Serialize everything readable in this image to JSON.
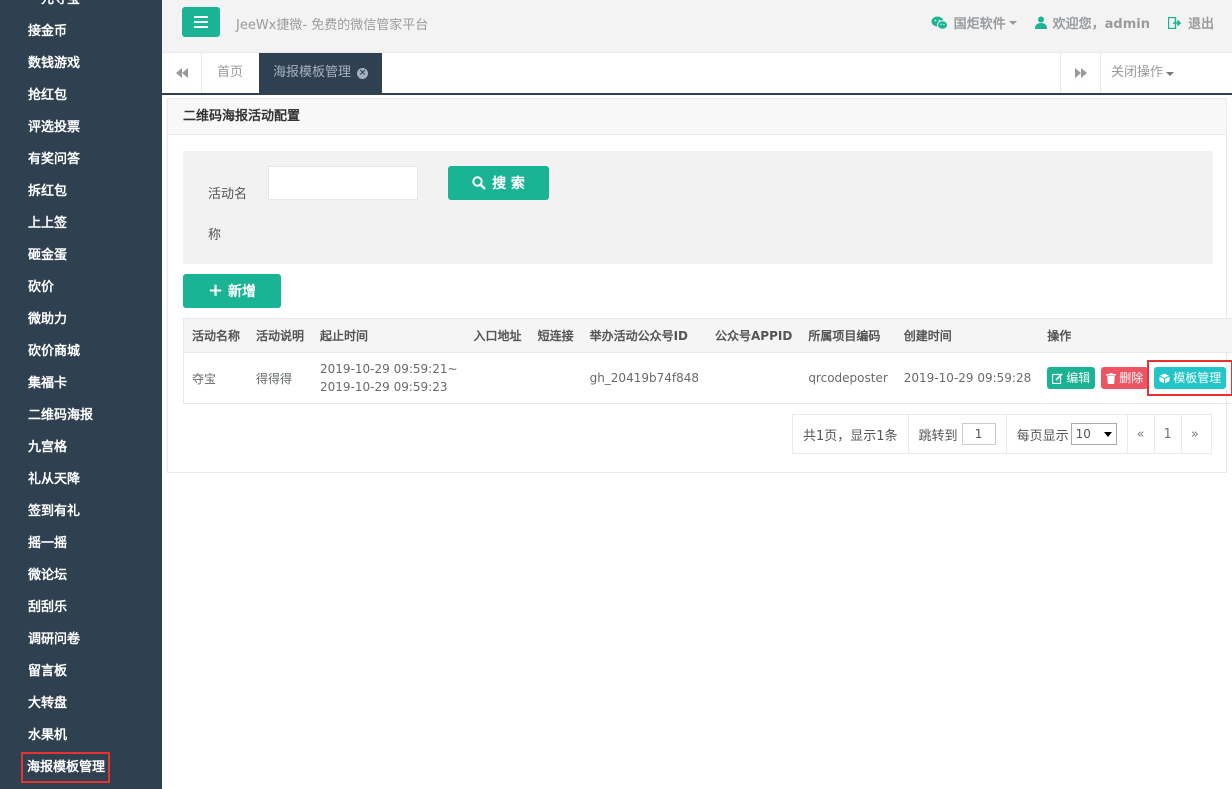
{
  "sidebar": {
    "items": [
      {
        "label": "一元夺宝"
      },
      {
        "label": "接金币"
      },
      {
        "label": "数钱游戏"
      },
      {
        "label": "抢红包"
      },
      {
        "label": "评选投票"
      },
      {
        "label": "有奖问答"
      },
      {
        "label": "拆红包"
      },
      {
        "label": "上上签"
      },
      {
        "label": "砸金蛋"
      },
      {
        "label": "砍价"
      },
      {
        "label": "微助力"
      },
      {
        "label": "砍价商城"
      },
      {
        "label": "集福卡"
      },
      {
        "label": "二维码海报"
      },
      {
        "label": "九宫格"
      },
      {
        "label": "礼从天降"
      },
      {
        "label": "签到有礼"
      },
      {
        "label": "摇一摇"
      },
      {
        "label": "微论坛"
      },
      {
        "label": "刮刮乐"
      },
      {
        "label": "调研问卷"
      },
      {
        "label": "留言板"
      },
      {
        "label": "大转盘"
      },
      {
        "label": "水果机"
      },
      {
        "label": "海报模板管理"
      }
    ]
  },
  "header": {
    "title": "JeeWx捷微- 免费的微信管家平台",
    "company": "国炬软件",
    "welcome": "欢迎您，admin",
    "logout": "退出"
  },
  "tabs": {
    "home": "首页",
    "active": "海报模板管理",
    "close_ops": "关闭操作"
  },
  "panel": {
    "title": "二维码海报活动配置",
    "search_label": "活动名称",
    "search_value": "",
    "search_button": "搜 索",
    "add_button": "新增"
  },
  "table": {
    "headers": [
      "活动名称",
      "活动说明",
      "起止时间",
      "入口地址",
      "短连接",
      "举办活动公众号ID",
      "公众号APPID",
      "所属项目编码",
      "创建时间",
      "操作"
    ],
    "rows": [
      {
        "name": "夺宝",
        "desc": "得得得",
        "time_start": "2019-10-29 09:59:21~",
        "time_end": "2019-10-29 09:59:23",
        "entry": "",
        "short_link": "",
        "gh_id": "gh_20419b74f848",
        "appid": "",
        "project": "qrcodeposter",
        "created": "2019-10-29 09:59:28",
        "edit": "编辑",
        "delete": "删除",
        "template": "模板管理"
      }
    ]
  },
  "pager": {
    "summary": "共1页，显示1条",
    "jump_label": "跳转到",
    "jump_value": "1",
    "size_label": "每页显示",
    "size_value": "10",
    "prev": "«",
    "page": "1",
    "next": "»"
  },
  "colors": {
    "sidebar_bg": "#2f4050",
    "primary": "#1ab394",
    "danger": "#ed5565",
    "info": "#23c6c8",
    "highlight": "#e8322f"
  }
}
